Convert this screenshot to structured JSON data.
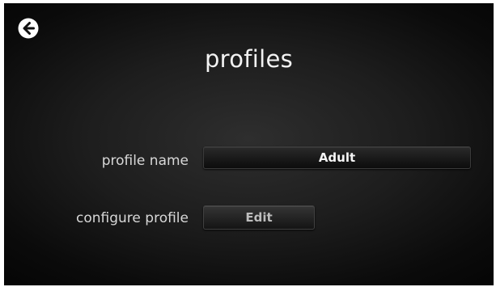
{
  "header": {
    "back_icon": "back-arrow-icon",
    "title": "profiles"
  },
  "form": {
    "profile_name_label": "profile name",
    "profile_name_value": "Adult",
    "configure_label": "configure profile",
    "edit_label": "Edit"
  },
  "colors": {
    "background": "#1d1d1d",
    "text": "#f2f2f2",
    "button": "#2a2a2a"
  }
}
